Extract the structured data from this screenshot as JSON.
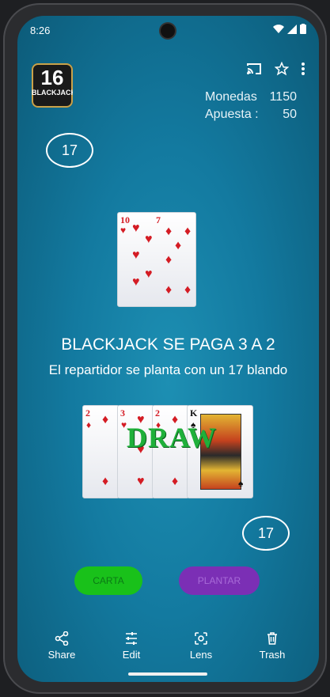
{
  "status": {
    "time": "8:26"
  },
  "header": {
    "logo_number": "16",
    "logo_text": "BLACKJACK",
    "monedas_label": "Monedas",
    "monedas_value": "1150",
    "apuesta_label": "Apuesta :",
    "apuesta_value": "50"
  },
  "dealer": {
    "score": "17",
    "card": {
      "rank": "10",
      "suit": "hearts"
    },
    "card2": {
      "rank": "7",
      "suit": "diamonds"
    }
  },
  "info": {
    "headline": "BLACKJACK SE PAGA 3 A 2",
    "subline": "El repartidor se planta con un 17 blando"
  },
  "player": {
    "score": "17",
    "cards": [
      {
        "rank": "2",
        "suit": "diamonds"
      },
      {
        "rank": "3",
        "suit": "hearts"
      },
      {
        "rank": "2",
        "suit": "diamonds"
      },
      {
        "rank": "K",
        "suit": "spades"
      }
    ],
    "result": "DRAW"
  },
  "actions": {
    "hit_label": "CARTA",
    "stand_label": "PLANTAR"
  },
  "bottom_nav": {
    "share": "Share",
    "edit": "Edit",
    "lens": "Lens",
    "trash": "Trash"
  },
  "colors": {
    "table": "#137aa0",
    "hit": "#19c11a",
    "stand": "#7b2fb5",
    "result": "#1fb03a"
  }
}
